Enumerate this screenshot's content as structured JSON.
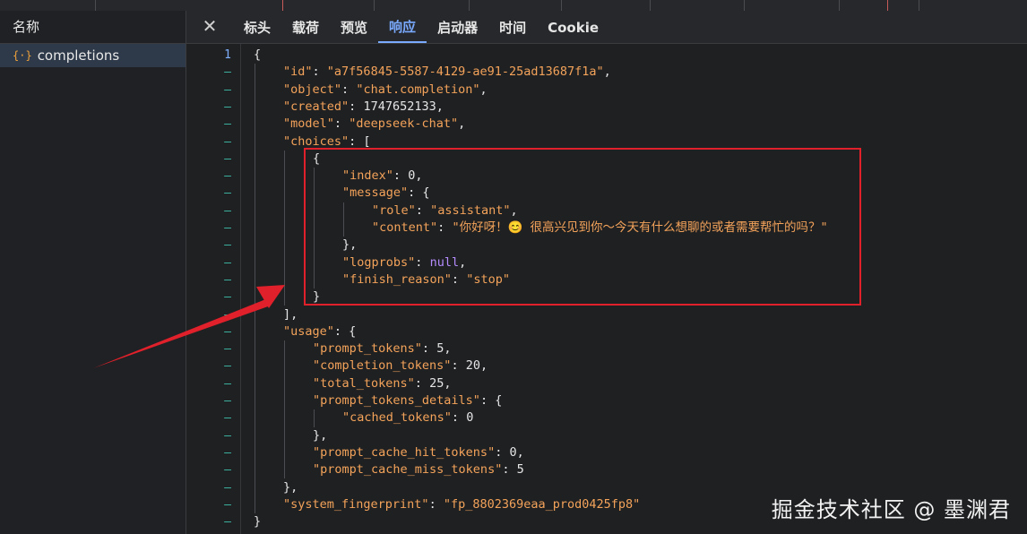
{
  "left_panel": {
    "header": "名称",
    "request": {
      "icon": "json-icon",
      "name": "completions"
    }
  },
  "tabs": [
    "标头",
    "载荷",
    "预览",
    "响应",
    "启动器",
    "时间",
    "Cookie"
  ],
  "active_tab": "响应",
  "gutter": {
    "first_line_number": "1",
    "dash": "–"
  },
  "response_lines": [
    "{",
    "\"id\": \"a7f56845-5587-4129-ae91-25ad13687f1a\",",
    "\"object\": \"chat.completion\",",
    "\"created\": 1747652133,",
    "\"model\": \"deepseek-chat\",",
    "\"choices\": [",
    "{",
    "\"index\": 0,",
    "\"message\": {",
    "\"role\": \"assistant\",",
    "\"content\": \"你好呀！😊 很高兴见到你～今天有什么想聊的或者需要帮忙的吗？\"",
    "},",
    "\"logprobs\": null,",
    "\"finish_reason\": \"stop\"",
    "}",
    "],",
    "\"usage\": {",
    "\"prompt_tokens\": 5,",
    "\"completion_tokens\": 20,",
    "\"total_tokens\": 25,",
    "\"prompt_tokens_details\": {",
    "\"cached_tokens\": 0",
    "},",
    "\"prompt_cache_hit_tokens\": 0,",
    "\"prompt_cache_miss_tokens\": 5",
    "},",
    "\"system_fingerprint\": \"fp_8802369eaa_prod0425fp8\"",
    "}"
  ],
  "watermark": "掘金技术社区 @ 墨渊君",
  "colors": {
    "highlight_box": "#e0202a",
    "accent": "#7aaaff",
    "string": "#f4a35a",
    "null": "#b48cff"
  }
}
